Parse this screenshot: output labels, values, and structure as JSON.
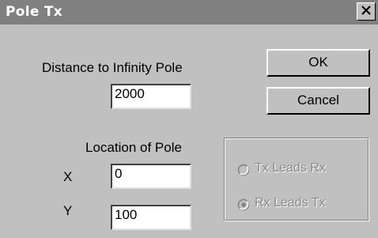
{
  "window": {
    "title": "Pole Tx",
    "close_symbol": "✕"
  },
  "distance": {
    "label": "Distance to Infinity Pole",
    "value": "2000"
  },
  "location": {
    "label": "Location of Pole",
    "x_label": "X",
    "x_value": "0",
    "y_label": "Y",
    "y_value": "100"
  },
  "buttons": {
    "ok_label": "OK",
    "cancel_label": "Cancel"
  },
  "lead_options": [
    {
      "label": "Tx Leads Rx",
      "selected": false,
      "enabled": false
    },
    {
      "label": "Rx Leads Tx",
      "selected": true,
      "enabled": false
    }
  ],
  "icons": {
    "close": "close-icon",
    "radio_unselected": "radio-unselected-icon",
    "radio_selected": "radio-selected-icon"
  }
}
